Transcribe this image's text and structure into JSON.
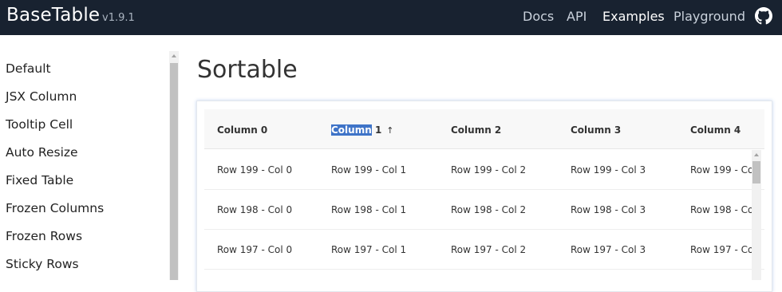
{
  "header": {
    "brand": "BaseTable",
    "version": "v1.9.1",
    "nav": [
      {
        "label": "Docs"
      },
      {
        "label": "API"
      },
      {
        "label": "Examples"
      },
      {
        "label": "Playground"
      }
    ],
    "active_nav": "Examples"
  },
  "sidebar": {
    "items": [
      {
        "label": "Default"
      },
      {
        "label": "JSX Column"
      },
      {
        "label": "Tooltip Cell"
      },
      {
        "label": "Auto Resize"
      },
      {
        "label": "Fixed Table"
      },
      {
        "label": "Frozen Columns"
      },
      {
        "label": "Frozen Rows"
      },
      {
        "label": "Sticky Rows"
      }
    ]
  },
  "main": {
    "title": "Sortable",
    "table": {
      "columns": [
        {
          "label": "Column 0"
        },
        {
          "label_selected": "Column",
          "label_rest": " 1",
          "sort_indicator": "↑"
        },
        {
          "label": "Column 2"
        },
        {
          "label": "Column 3"
        },
        {
          "label": "Column 4"
        }
      ],
      "rows": [
        [
          "Row 199 - Col 0",
          "Row 199 - Col 1",
          "Row 199 - Col 2",
          "Row 199 - Col 3",
          "Row 199 - Co"
        ],
        [
          "Row 198 - Col 0",
          "Row 198 - Col 1",
          "Row 198 - Col 2",
          "Row 198 - Col 3",
          "Row 198 - Co"
        ],
        [
          "Row 197 - Col 0",
          "Row 197 - Col 1",
          "Row 197 - Col 2",
          "Row 197 - Col 3",
          "Row 197 - Co"
        ]
      ]
    }
  },
  "colors": {
    "header_bg": "#182230",
    "selection": "#3f74c8"
  },
  "icons": {
    "github": "github-icon"
  }
}
